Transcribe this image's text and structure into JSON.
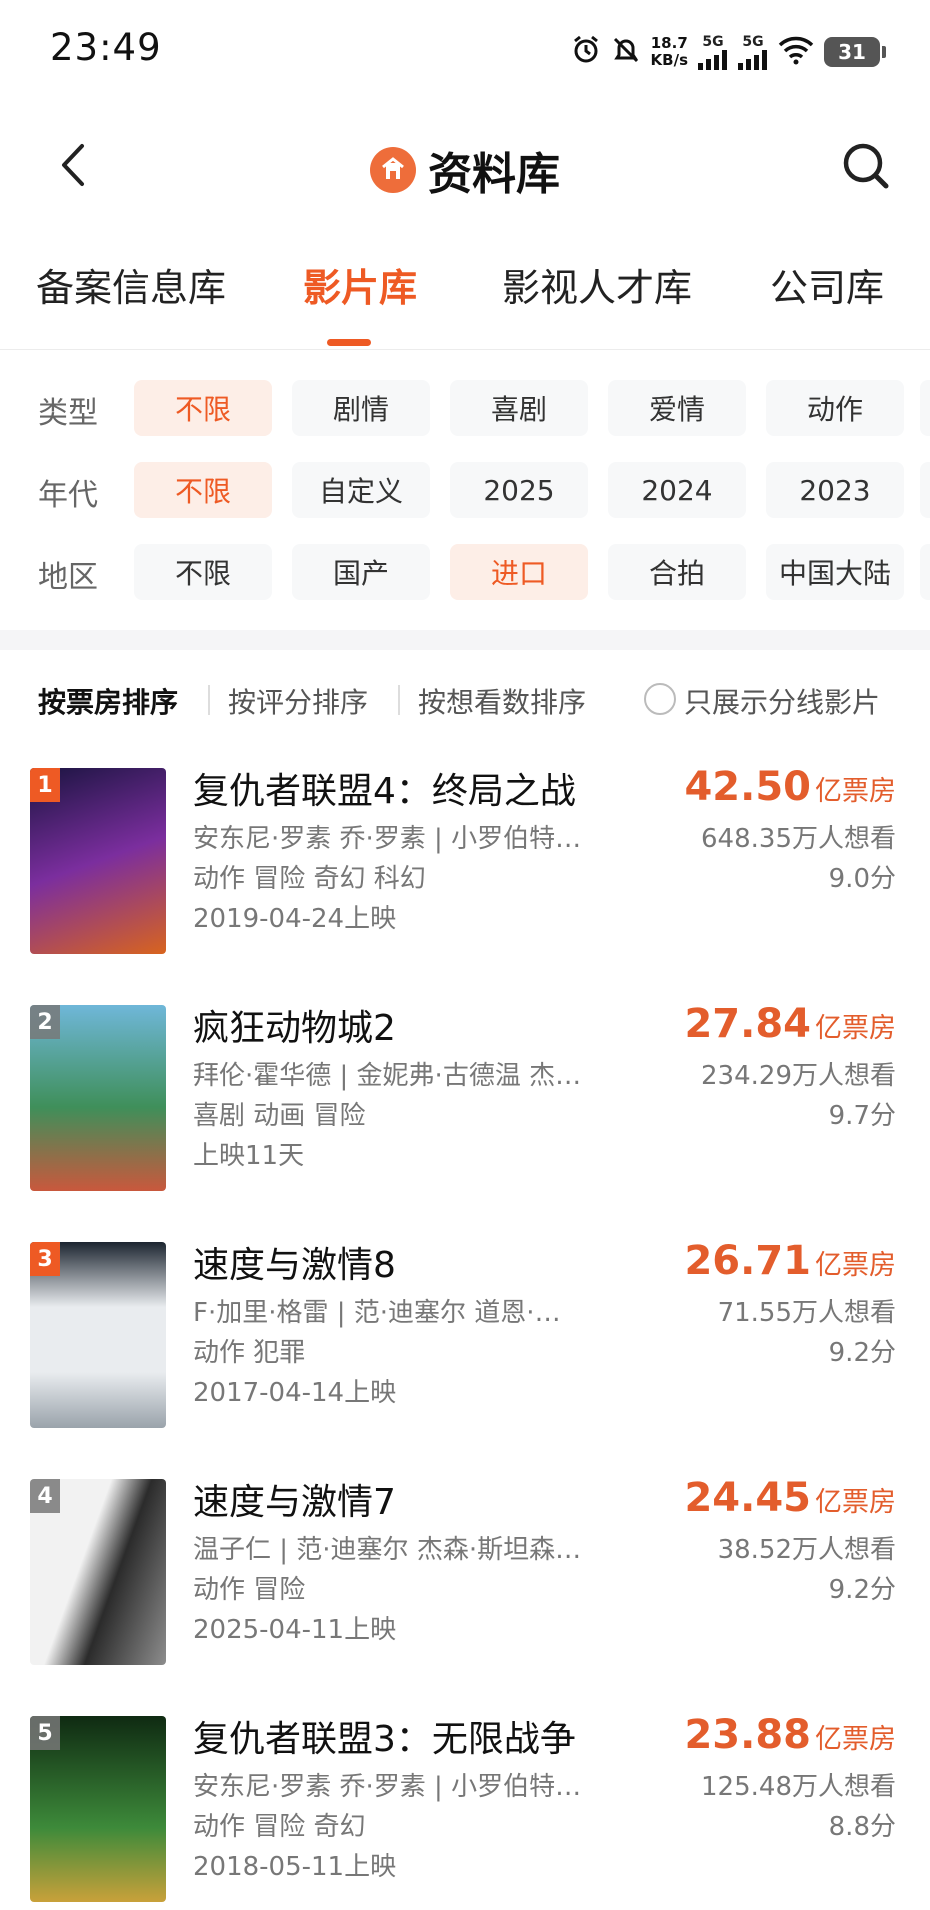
{
  "status": {
    "time": "23:49",
    "net_speed": "18.7",
    "net_speed_unit": "KB/s",
    "sim1": "5G",
    "sim2": "5G",
    "battery": "31"
  },
  "header": {
    "title": "资料库"
  },
  "tabs": [
    {
      "label": "备案信息库",
      "active": false
    },
    {
      "label": "影片库",
      "active": true
    },
    {
      "label": "影视人才库",
      "active": false
    },
    {
      "label": "公司库",
      "active": false
    }
  ],
  "filters": [
    {
      "label": "类型",
      "chips": [
        "不限",
        "剧情",
        "喜剧",
        "爱情",
        "动作"
      ],
      "selected": 0
    },
    {
      "label": "年代",
      "chips": [
        "不限",
        "自定义",
        "2025",
        "2024",
        "2023"
      ],
      "selected": 0
    },
    {
      "label": "地区",
      "chips": [
        "不限",
        "国产",
        "进口",
        "合拍",
        "中国大陆"
      ],
      "selected": 2
    }
  ],
  "sort": {
    "options": [
      "按票房排序",
      "按评分排序",
      "按想看数排序"
    ],
    "active": 0,
    "toggle_label": "只展示分线影片"
  },
  "films": [
    {
      "rank": "1",
      "title": "复仇者联盟4：终局之战",
      "cast": "安东尼·罗素 乔·罗素 | 小罗伯特…",
      "genres": "动作 冒险 奇幻 科幻",
      "release": "2019-04-24上映",
      "box_office": "42.50",
      "box_unit": "亿票房",
      "want": "648.35万人想看",
      "score": "9.0分",
      "poster_colors": [
        "#1a1440",
        "#7b2e9e",
        "#d8641e"
      ]
    },
    {
      "rank": "2",
      "title": "疯狂动物城2",
      "cast": "拜伦·霍华德 | 金妮弗·古德温 杰…",
      "genres": "喜剧 动画 冒险",
      "release": "上映11天",
      "box_office": "27.84",
      "box_unit": "亿票房",
      "want": "234.29万人想看",
      "score": "9.7分",
      "poster_colors": [
        "#6fb7d9",
        "#3f8f5a",
        "#c9583d"
      ]
    },
    {
      "rank": "3",
      "title": "速度与激情8",
      "cast": "F·加里·格雷 | 范·迪塞尔 道恩·…",
      "genres": "动作 犯罪",
      "release": "2017-04-14上映",
      "box_office": "26.71",
      "box_unit": "亿票房",
      "want": "71.55万人想看",
      "score": "9.2分",
      "poster_colors": [
        "#e9ecef",
        "#1c2530",
        "#9aa3ab"
      ]
    },
    {
      "rank": "4",
      "title": "速度与激情7",
      "cast": "温子仁 | 范·迪塞尔 杰森·斯坦森…",
      "genres": "动作 冒险",
      "release": "2025-04-11上映",
      "box_office": "24.45",
      "box_unit": "亿票房",
      "want": "38.52万人想看",
      "score": "9.2分",
      "poster_colors": [
        "#f2f2f2",
        "#2b2b2b",
        "#8d8d8d"
      ]
    },
    {
      "rank": "5",
      "title": "复仇者联盟3：无限战争",
      "cast": "安东尼·罗素 乔·罗素 | 小罗伯特…",
      "genres": "动作 冒险 奇幻",
      "release": "2018-05-11上映",
      "box_office": "23.88",
      "box_unit": "亿票房",
      "want": "125.48万人想看",
      "score": "8.8分",
      "poster_colors": [
        "#0f2a12",
        "#3d8a3a",
        "#c9a13a"
      ]
    }
  ],
  "colors": {
    "accent": "#ee5a24",
    "box_office": "#e35d2c"
  }
}
